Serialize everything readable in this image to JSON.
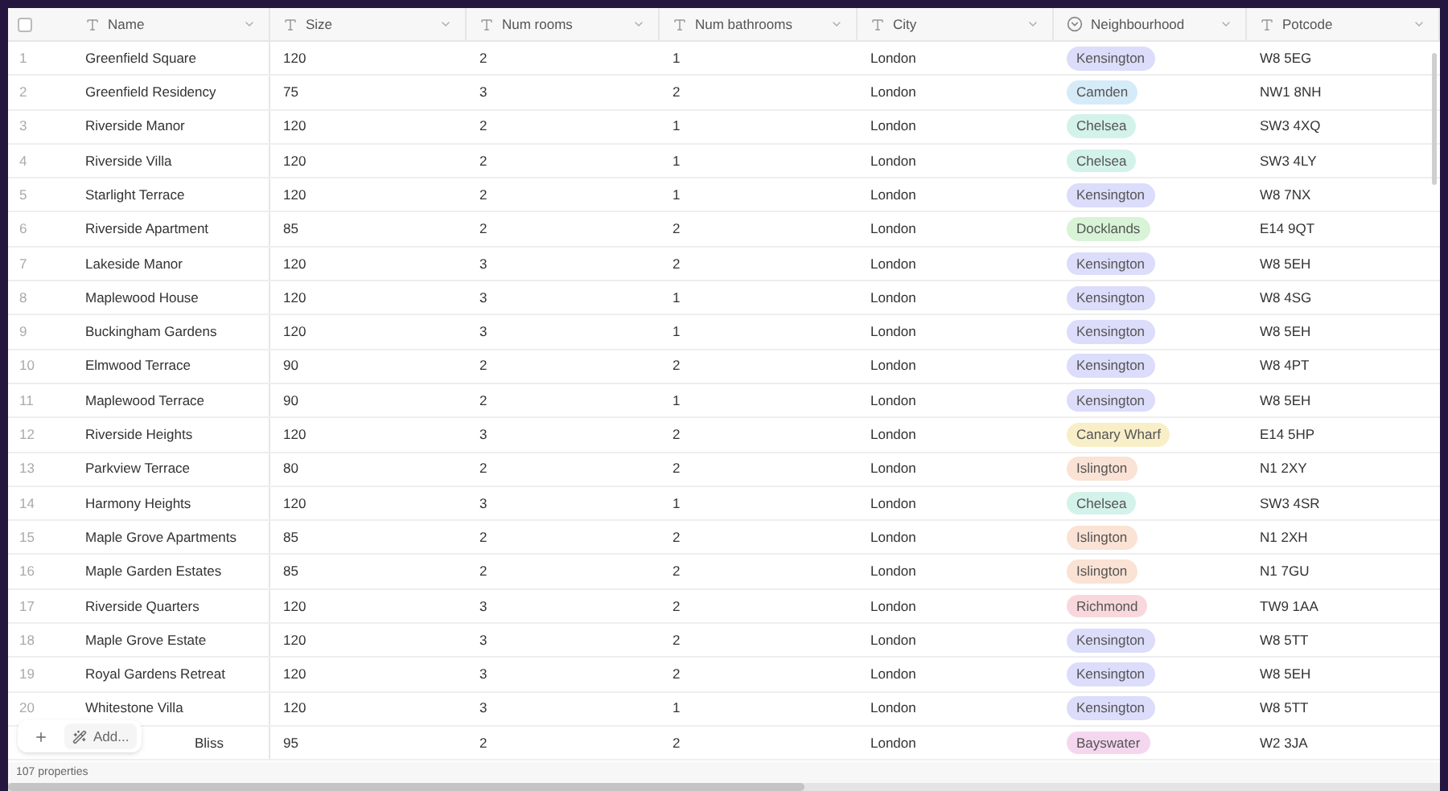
{
  "select_all": {
    "checked": false
  },
  "columns": [
    {
      "label": "Name",
      "kind": "text"
    },
    {
      "label": "Size",
      "kind": "text"
    },
    {
      "label": "Num rooms",
      "kind": "text"
    },
    {
      "label": "Num bathrooms",
      "kind": "text"
    },
    {
      "label": "City",
      "kind": "text"
    },
    {
      "label": "Neighbourhood",
      "kind": "select"
    },
    {
      "label": "Potcode",
      "kind": "text"
    }
  ],
  "rows": [
    {
      "number": "1",
      "name": "Greenfield Square",
      "size": "120",
      "rooms": "2",
      "bathrooms": "1",
      "city": "London",
      "neighbourhood": {
        "label": "Kensington",
        "color": "#dcdcfb"
      },
      "postcode": "W8 5EG"
    },
    {
      "number": "2",
      "name": "Greenfield Residency",
      "size": "75",
      "rooms": "3",
      "bathrooms": "2",
      "city": "London",
      "neighbourhood": {
        "label": "Camden",
        "color": "#d6ebf8"
      },
      "postcode": "NW1 8NH"
    },
    {
      "number": "3",
      "name": "Riverside Manor",
      "size": "120",
      "rooms": "2",
      "bathrooms": "1",
      "city": "London",
      "neighbourhood": {
        "label": "Chelsea",
        "color": "#d3f2ea"
      },
      "postcode": "SW3 4XQ"
    },
    {
      "number": "4",
      "name": "Riverside Villa",
      "size": "120",
      "rooms": "2",
      "bathrooms": "1",
      "city": "London",
      "neighbourhood": {
        "label": "Chelsea",
        "color": "#d3f2ea"
      },
      "postcode": "SW3 4LY"
    },
    {
      "number": "5",
      "name": "Starlight Terrace",
      "size": "120",
      "rooms": "2",
      "bathrooms": "1",
      "city": "London",
      "neighbourhood": {
        "label": "Kensington",
        "color": "#dcdcfb"
      },
      "postcode": "W8 7NX"
    },
    {
      "number": "6",
      "name": "Riverside Apartment",
      "size": "85",
      "rooms": "2",
      "bathrooms": "2",
      "city": "London",
      "neighbourhood": {
        "label": "Docklands",
        "color": "#d8f3d6"
      },
      "postcode": "E14 9QT"
    },
    {
      "number": "7",
      "name": "Lakeside Manor",
      "size": "120",
      "rooms": "3",
      "bathrooms": "2",
      "city": "London",
      "neighbourhood": {
        "label": "Kensington",
        "color": "#dcdcfb"
      },
      "postcode": "W8 5EH"
    },
    {
      "number": "8",
      "name": "Maplewood House",
      "size": "120",
      "rooms": "3",
      "bathrooms": "1",
      "city": "London",
      "neighbourhood": {
        "label": "Kensington",
        "color": "#dcdcfb"
      },
      "postcode": "W8 4SG"
    },
    {
      "number": "9",
      "name": "Buckingham Gardens",
      "size": "120",
      "rooms": "3",
      "bathrooms": "1",
      "city": "London",
      "neighbourhood": {
        "label": "Kensington",
        "color": "#dcdcfb"
      },
      "postcode": "W8 5EH"
    },
    {
      "number": "10",
      "name": "Elmwood Terrace",
      "size": "90",
      "rooms": "2",
      "bathrooms": "2",
      "city": "London",
      "neighbourhood": {
        "label": "Kensington",
        "color": "#dcdcfb"
      },
      "postcode": "W8 4PT"
    },
    {
      "number": "11",
      "name": "Maplewood Terrace",
      "size": "90",
      "rooms": "2",
      "bathrooms": "1",
      "city": "London",
      "neighbourhood": {
        "label": "Kensington",
        "color": "#dcdcfb"
      },
      "postcode": "W8 5EH"
    },
    {
      "number": "12",
      "name": "Riverside Heights",
      "size": "120",
      "rooms": "3",
      "bathrooms": "2",
      "city": "London",
      "neighbourhood": {
        "label": "Canary Wharf",
        "color": "#f8eec8"
      },
      "postcode": "E14 5HP"
    },
    {
      "number": "13",
      "name": "Parkview Terrace",
      "size": "80",
      "rooms": "2",
      "bathrooms": "2",
      "city": "London",
      "neighbourhood": {
        "label": "Islington",
        "color": "#fae2d4"
      },
      "postcode": "N1 2XY"
    },
    {
      "number": "14",
      "name": "Harmony Heights",
      "size": "120",
      "rooms": "3",
      "bathrooms": "1",
      "city": "London",
      "neighbourhood": {
        "label": "Chelsea",
        "color": "#d3f2ea"
      },
      "postcode": "SW3 4SR"
    },
    {
      "number": "15",
      "name": "Maple Grove Apartments",
      "size": "85",
      "rooms": "2",
      "bathrooms": "2",
      "city": "London",
      "neighbourhood": {
        "label": "Islington",
        "color": "#fae2d4"
      },
      "postcode": "N1 2XH"
    },
    {
      "number": "16",
      "name": "Maple Garden Estates",
      "size": "85",
      "rooms": "2",
      "bathrooms": "2",
      "city": "London",
      "neighbourhood": {
        "label": "Islington",
        "color": "#fae2d4"
      },
      "postcode": "N1 7GU"
    },
    {
      "number": "17",
      "name": "Riverside Quarters",
      "size": "120",
      "rooms": "3",
      "bathrooms": "2",
      "city": "London",
      "neighbourhood": {
        "label": "Richmond",
        "color": "#f8d8dc"
      },
      "postcode": "TW9 1AA"
    },
    {
      "number": "18",
      "name": "Maple Grove Estate",
      "size": "120",
      "rooms": "3",
      "bathrooms": "2",
      "city": "London",
      "neighbourhood": {
        "label": "Kensington",
        "color": "#dcdcfb"
      },
      "postcode": "W8 5TT"
    },
    {
      "number": "19",
      "name": "Royal Gardens Retreat",
      "size": "120",
      "rooms": "3",
      "bathrooms": "2",
      "city": "London",
      "neighbourhood": {
        "label": "Kensington",
        "color": "#dcdcfb"
      },
      "postcode": "W8 5EH"
    },
    {
      "number": "20",
      "name": "Whitestone Villa",
      "size": "120",
      "rooms": "3",
      "bathrooms": "1",
      "city": "London",
      "neighbourhood": {
        "label": "Kensington",
        "color": "#dcdcfb"
      },
      "postcode": "W8 5TT"
    },
    {
      "name": "Bliss",
      "size": "95",
      "rooms": "2",
      "bathrooms": "2",
      "city": "London",
      "neighbourhood": {
        "label": "Bayswater",
        "color": "#f5d6ef"
      },
      "postcode": "W2 3JA"
    }
  ],
  "add_bar": {
    "add_label": "Add..."
  },
  "footer": {
    "count": "107 properties"
  }
}
